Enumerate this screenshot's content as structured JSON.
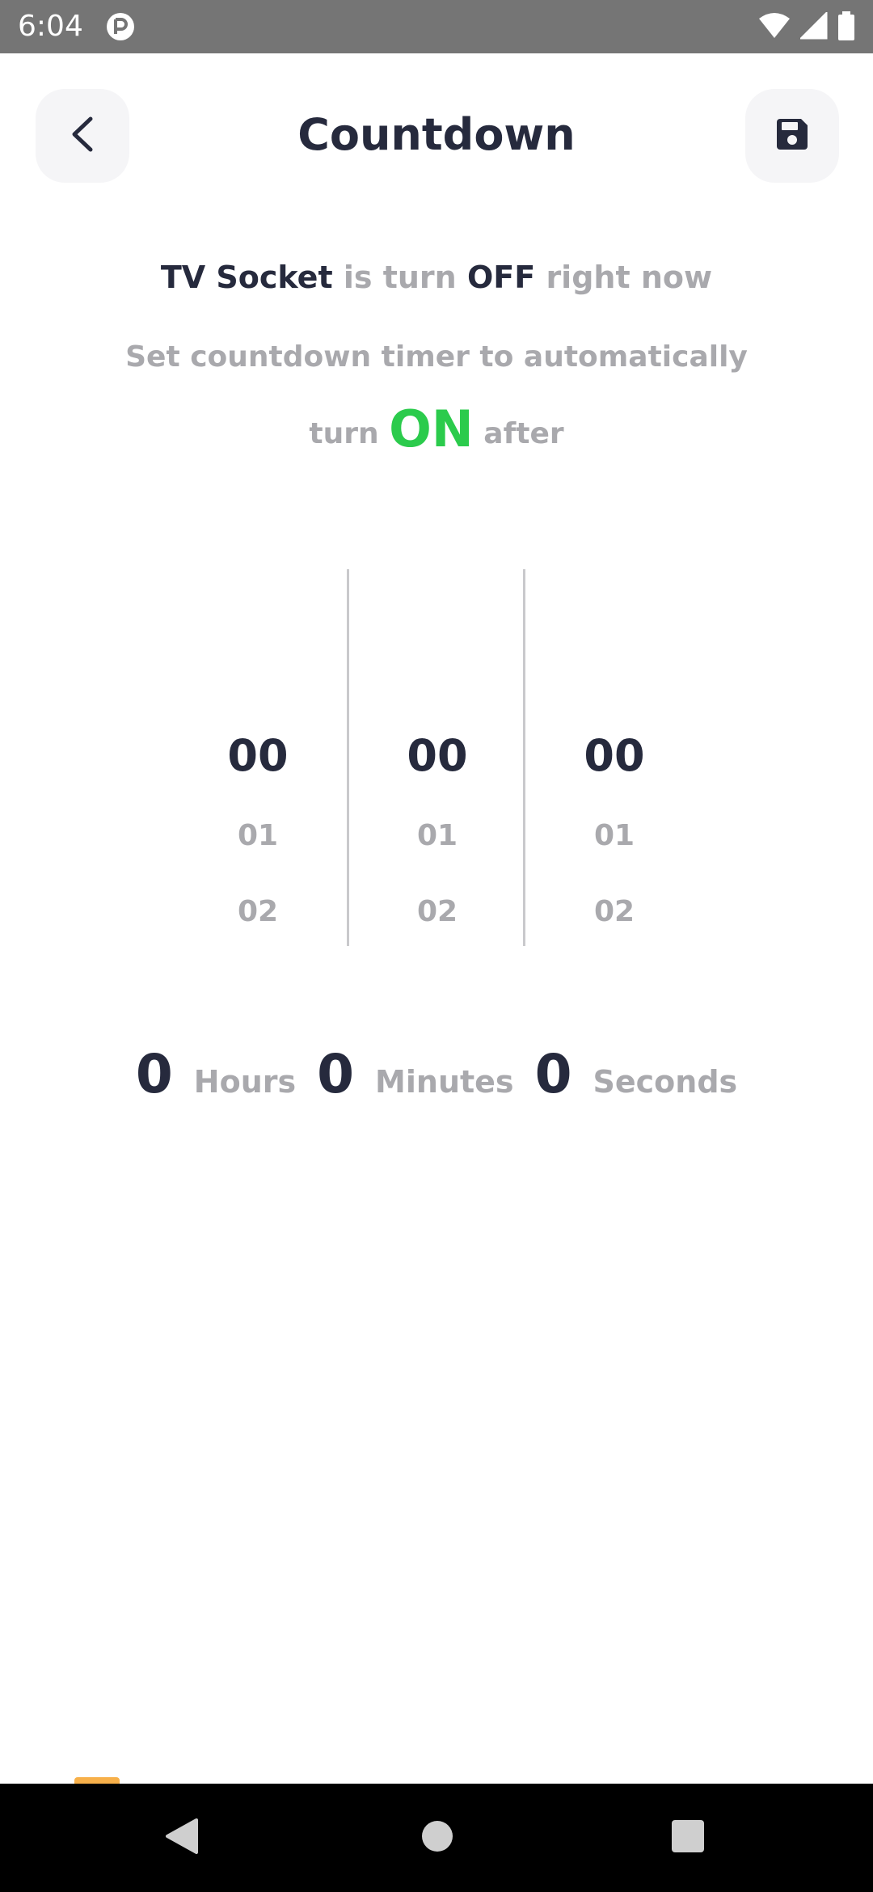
{
  "status_bar": {
    "time": "6:04"
  },
  "header": {
    "title": "Countdown"
  },
  "status": {
    "device": "TV Socket",
    "mid": "is turn",
    "state": "OFF",
    "tail": "right now"
  },
  "instruction": {
    "line1": "Set countdown timer to automatically",
    "pre": "turn",
    "action": "ON",
    "post": "after"
  },
  "picker": {
    "hours": {
      "selected": "00",
      "next1": "01",
      "next2": "02"
    },
    "minutes": {
      "selected": "00",
      "next1": "01",
      "next2": "02"
    },
    "seconds": {
      "selected": "00",
      "next1": "01",
      "next2": "02"
    }
  },
  "summary": {
    "hours_value": "0",
    "hours_label": "Hours",
    "minutes_value": "0",
    "minutes_label": "Minutes",
    "seconds_value": "0",
    "seconds_label": "Seconds"
  },
  "colors": {
    "accent_on": "#2bcb4c",
    "dark_text": "#262a3d",
    "muted_text": "#a9a9ad"
  },
  "icons": [
    "back-arrow-icon",
    "save-floppy-icon",
    "wifi-icon",
    "cell-signal-icon",
    "battery-icon",
    "nav-back-icon",
    "nav-home-icon",
    "nav-recent-icon"
  ]
}
